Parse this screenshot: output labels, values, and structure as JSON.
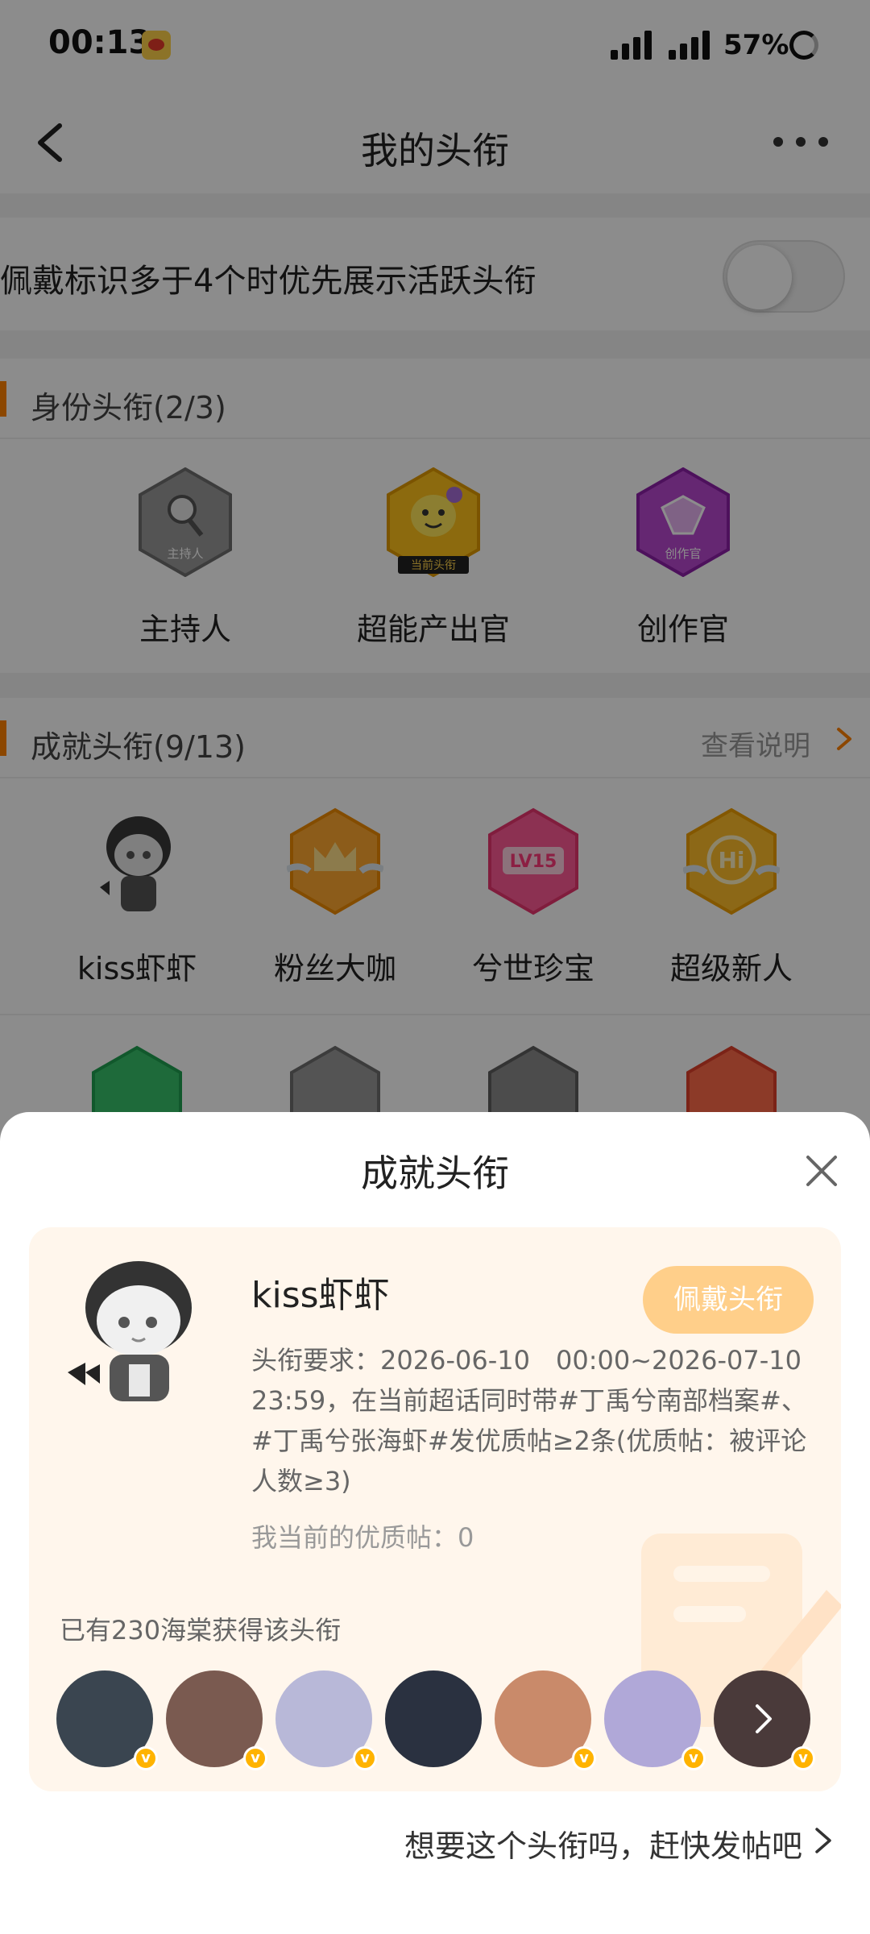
{
  "status_bar": {
    "time": "00:13",
    "battery": "57%"
  },
  "header": {
    "title": "我的头衔"
  },
  "settings": {
    "priority_toggle_label": "佩戴标识多于4个时优先展示活跃头衔",
    "priority_toggle_on": false
  },
  "identity_section": {
    "title": "身份头衔(2/3)",
    "badges": [
      {
        "label": "主持人",
        "badge_text": "主持人",
        "color": "#8c8c8c"
      },
      {
        "label": "超能产出官",
        "badge_text": "当前头衔",
        "color": "#ffb400"
      },
      {
        "label": "创作官",
        "badge_text": "创作官",
        "color": "#b13cc7"
      }
    ]
  },
  "achievement_section": {
    "title": "成就头衔(9/13)",
    "link": "查看说明",
    "badges": [
      {
        "label": "kiss虾虾",
        "color": "#777777"
      },
      {
        "label": "粉丝大咖",
        "color": "#ff9a2a"
      },
      {
        "label": "兮世珍宝",
        "badge_text": "LV15",
        "color": "#ff4d8d"
      },
      {
        "label": "超级新人",
        "badge_text": "Hi",
        "color": "#ffb21a"
      }
    ]
  },
  "sheet": {
    "title": "成就头衔",
    "card": {
      "name": "kiss虾虾",
      "wear_button": "佩戴头衔",
      "requirement": "头衔要求：2026-06-10　00:00~2026-07-10 23:59，在当前超话同时带#丁禹兮南部档案#、#丁禹兮张海虾#发优质帖≥2条(优质帖：被评论人数≥3)",
      "current": "我当前的优质帖：0",
      "earned_count": "已有230海棠获得该头衔",
      "avatars": [
        {
          "color": "#3a4550"
        },
        {
          "color": "#7a5a50"
        },
        {
          "color": "#b8b8d8"
        },
        {
          "color": "#2a3140"
        },
        {
          "color": "#c98a6a"
        },
        {
          "color": "#b0a8d8"
        },
        {
          "color": "#4a3a3a"
        }
      ]
    },
    "post_link": "想要这个头衔吗，赶快发帖吧"
  },
  "colors": {
    "accent": "#ff8200",
    "wear_button": "#ffcf8a",
    "card_bg": "#fff6ec"
  }
}
